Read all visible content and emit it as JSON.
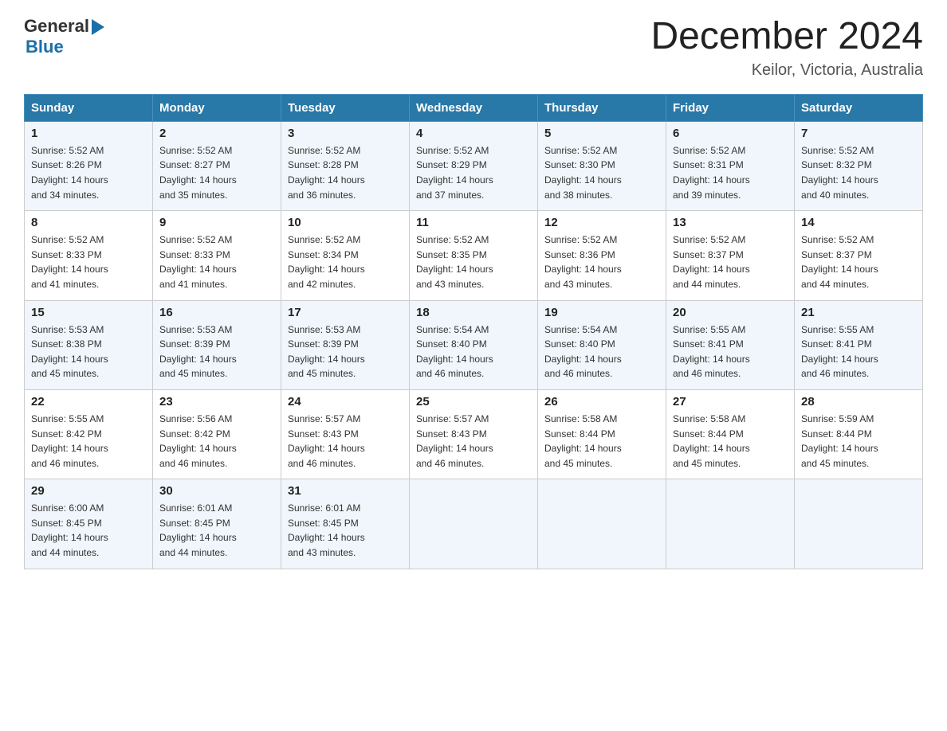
{
  "header": {
    "logo_general": "General",
    "logo_blue": "Blue",
    "month_title": "December 2024",
    "location": "Keilor, Victoria, Australia"
  },
  "days_of_week": [
    "Sunday",
    "Monday",
    "Tuesday",
    "Wednesday",
    "Thursday",
    "Friday",
    "Saturday"
  ],
  "weeks": [
    [
      {
        "day": "1",
        "sunrise": "5:52 AM",
        "sunset": "8:26 PM",
        "daylight": "14 hours and 34 minutes."
      },
      {
        "day": "2",
        "sunrise": "5:52 AM",
        "sunset": "8:27 PM",
        "daylight": "14 hours and 35 minutes."
      },
      {
        "day": "3",
        "sunrise": "5:52 AM",
        "sunset": "8:28 PM",
        "daylight": "14 hours and 36 minutes."
      },
      {
        "day": "4",
        "sunrise": "5:52 AM",
        "sunset": "8:29 PM",
        "daylight": "14 hours and 37 minutes."
      },
      {
        "day": "5",
        "sunrise": "5:52 AM",
        "sunset": "8:30 PM",
        "daylight": "14 hours and 38 minutes."
      },
      {
        "day": "6",
        "sunrise": "5:52 AM",
        "sunset": "8:31 PM",
        "daylight": "14 hours and 39 minutes."
      },
      {
        "day": "7",
        "sunrise": "5:52 AM",
        "sunset": "8:32 PM",
        "daylight": "14 hours and 40 minutes."
      }
    ],
    [
      {
        "day": "8",
        "sunrise": "5:52 AM",
        "sunset": "8:33 PM",
        "daylight": "14 hours and 41 minutes."
      },
      {
        "day": "9",
        "sunrise": "5:52 AM",
        "sunset": "8:33 PM",
        "daylight": "14 hours and 41 minutes."
      },
      {
        "day": "10",
        "sunrise": "5:52 AM",
        "sunset": "8:34 PM",
        "daylight": "14 hours and 42 minutes."
      },
      {
        "day": "11",
        "sunrise": "5:52 AM",
        "sunset": "8:35 PM",
        "daylight": "14 hours and 43 minutes."
      },
      {
        "day": "12",
        "sunrise": "5:52 AM",
        "sunset": "8:36 PM",
        "daylight": "14 hours and 43 minutes."
      },
      {
        "day": "13",
        "sunrise": "5:52 AM",
        "sunset": "8:37 PM",
        "daylight": "14 hours and 44 minutes."
      },
      {
        "day": "14",
        "sunrise": "5:52 AM",
        "sunset": "8:37 PM",
        "daylight": "14 hours and 44 minutes."
      }
    ],
    [
      {
        "day": "15",
        "sunrise": "5:53 AM",
        "sunset": "8:38 PM",
        "daylight": "14 hours and 45 minutes."
      },
      {
        "day": "16",
        "sunrise": "5:53 AM",
        "sunset": "8:39 PM",
        "daylight": "14 hours and 45 minutes."
      },
      {
        "day": "17",
        "sunrise": "5:53 AM",
        "sunset": "8:39 PM",
        "daylight": "14 hours and 45 minutes."
      },
      {
        "day": "18",
        "sunrise": "5:54 AM",
        "sunset": "8:40 PM",
        "daylight": "14 hours and 46 minutes."
      },
      {
        "day": "19",
        "sunrise": "5:54 AM",
        "sunset": "8:40 PM",
        "daylight": "14 hours and 46 minutes."
      },
      {
        "day": "20",
        "sunrise": "5:55 AM",
        "sunset": "8:41 PM",
        "daylight": "14 hours and 46 minutes."
      },
      {
        "day": "21",
        "sunrise": "5:55 AM",
        "sunset": "8:41 PM",
        "daylight": "14 hours and 46 minutes."
      }
    ],
    [
      {
        "day": "22",
        "sunrise": "5:55 AM",
        "sunset": "8:42 PM",
        "daylight": "14 hours and 46 minutes."
      },
      {
        "day": "23",
        "sunrise": "5:56 AM",
        "sunset": "8:42 PM",
        "daylight": "14 hours and 46 minutes."
      },
      {
        "day": "24",
        "sunrise": "5:57 AM",
        "sunset": "8:43 PM",
        "daylight": "14 hours and 46 minutes."
      },
      {
        "day": "25",
        "sunrise": "5:57 AM",
        "sunset": "8:43 PM",
        "daylight": "14 hours and 46 minutes."
      },
      {
        "day": "26",
        "sunrise": "5:58 AM",
        "sunset": "8:44 PM",
        "daylight": "14 hours and 45 minutes."
      },
      {
        "day": "27",
        "sunrise": "5:58 AM",
        "sunset": "8:44 PM",
        "daylight": "14 hours and 45 minutes."
      },
      {
        "day": "28",
        "sunrise": "5:59 AM",
        "sunset": "8:44 PM",
        "daylight": "14 hours and 45 minutes."
      }
    ],
    [
      {
        "day": "29",
        "sunrise": "6:00 AM",
        "sunset": "8:45 PM",
        "daylight": "14 hours and 44 minutes."
      },
      {
        "day": "30",
        "sunrise": "6:01 AM",
        "sunset": "8:45 PM",
        "daylight": "14 hours and 44 minutes."
      },
      {
        "day": "31",
        "sunrise": "6:01 AM",
        "sunset": "8:45 PM",
        "daylight": "14 hours and 43 minutes."
      },
      null,
      null,
      null,
      null
    ]
  ],
  "labels": {
    "sunrise": "Sunrise:",
    "sunset": "Sunset:",
    "daylight": "Daylight:"
  }
}
